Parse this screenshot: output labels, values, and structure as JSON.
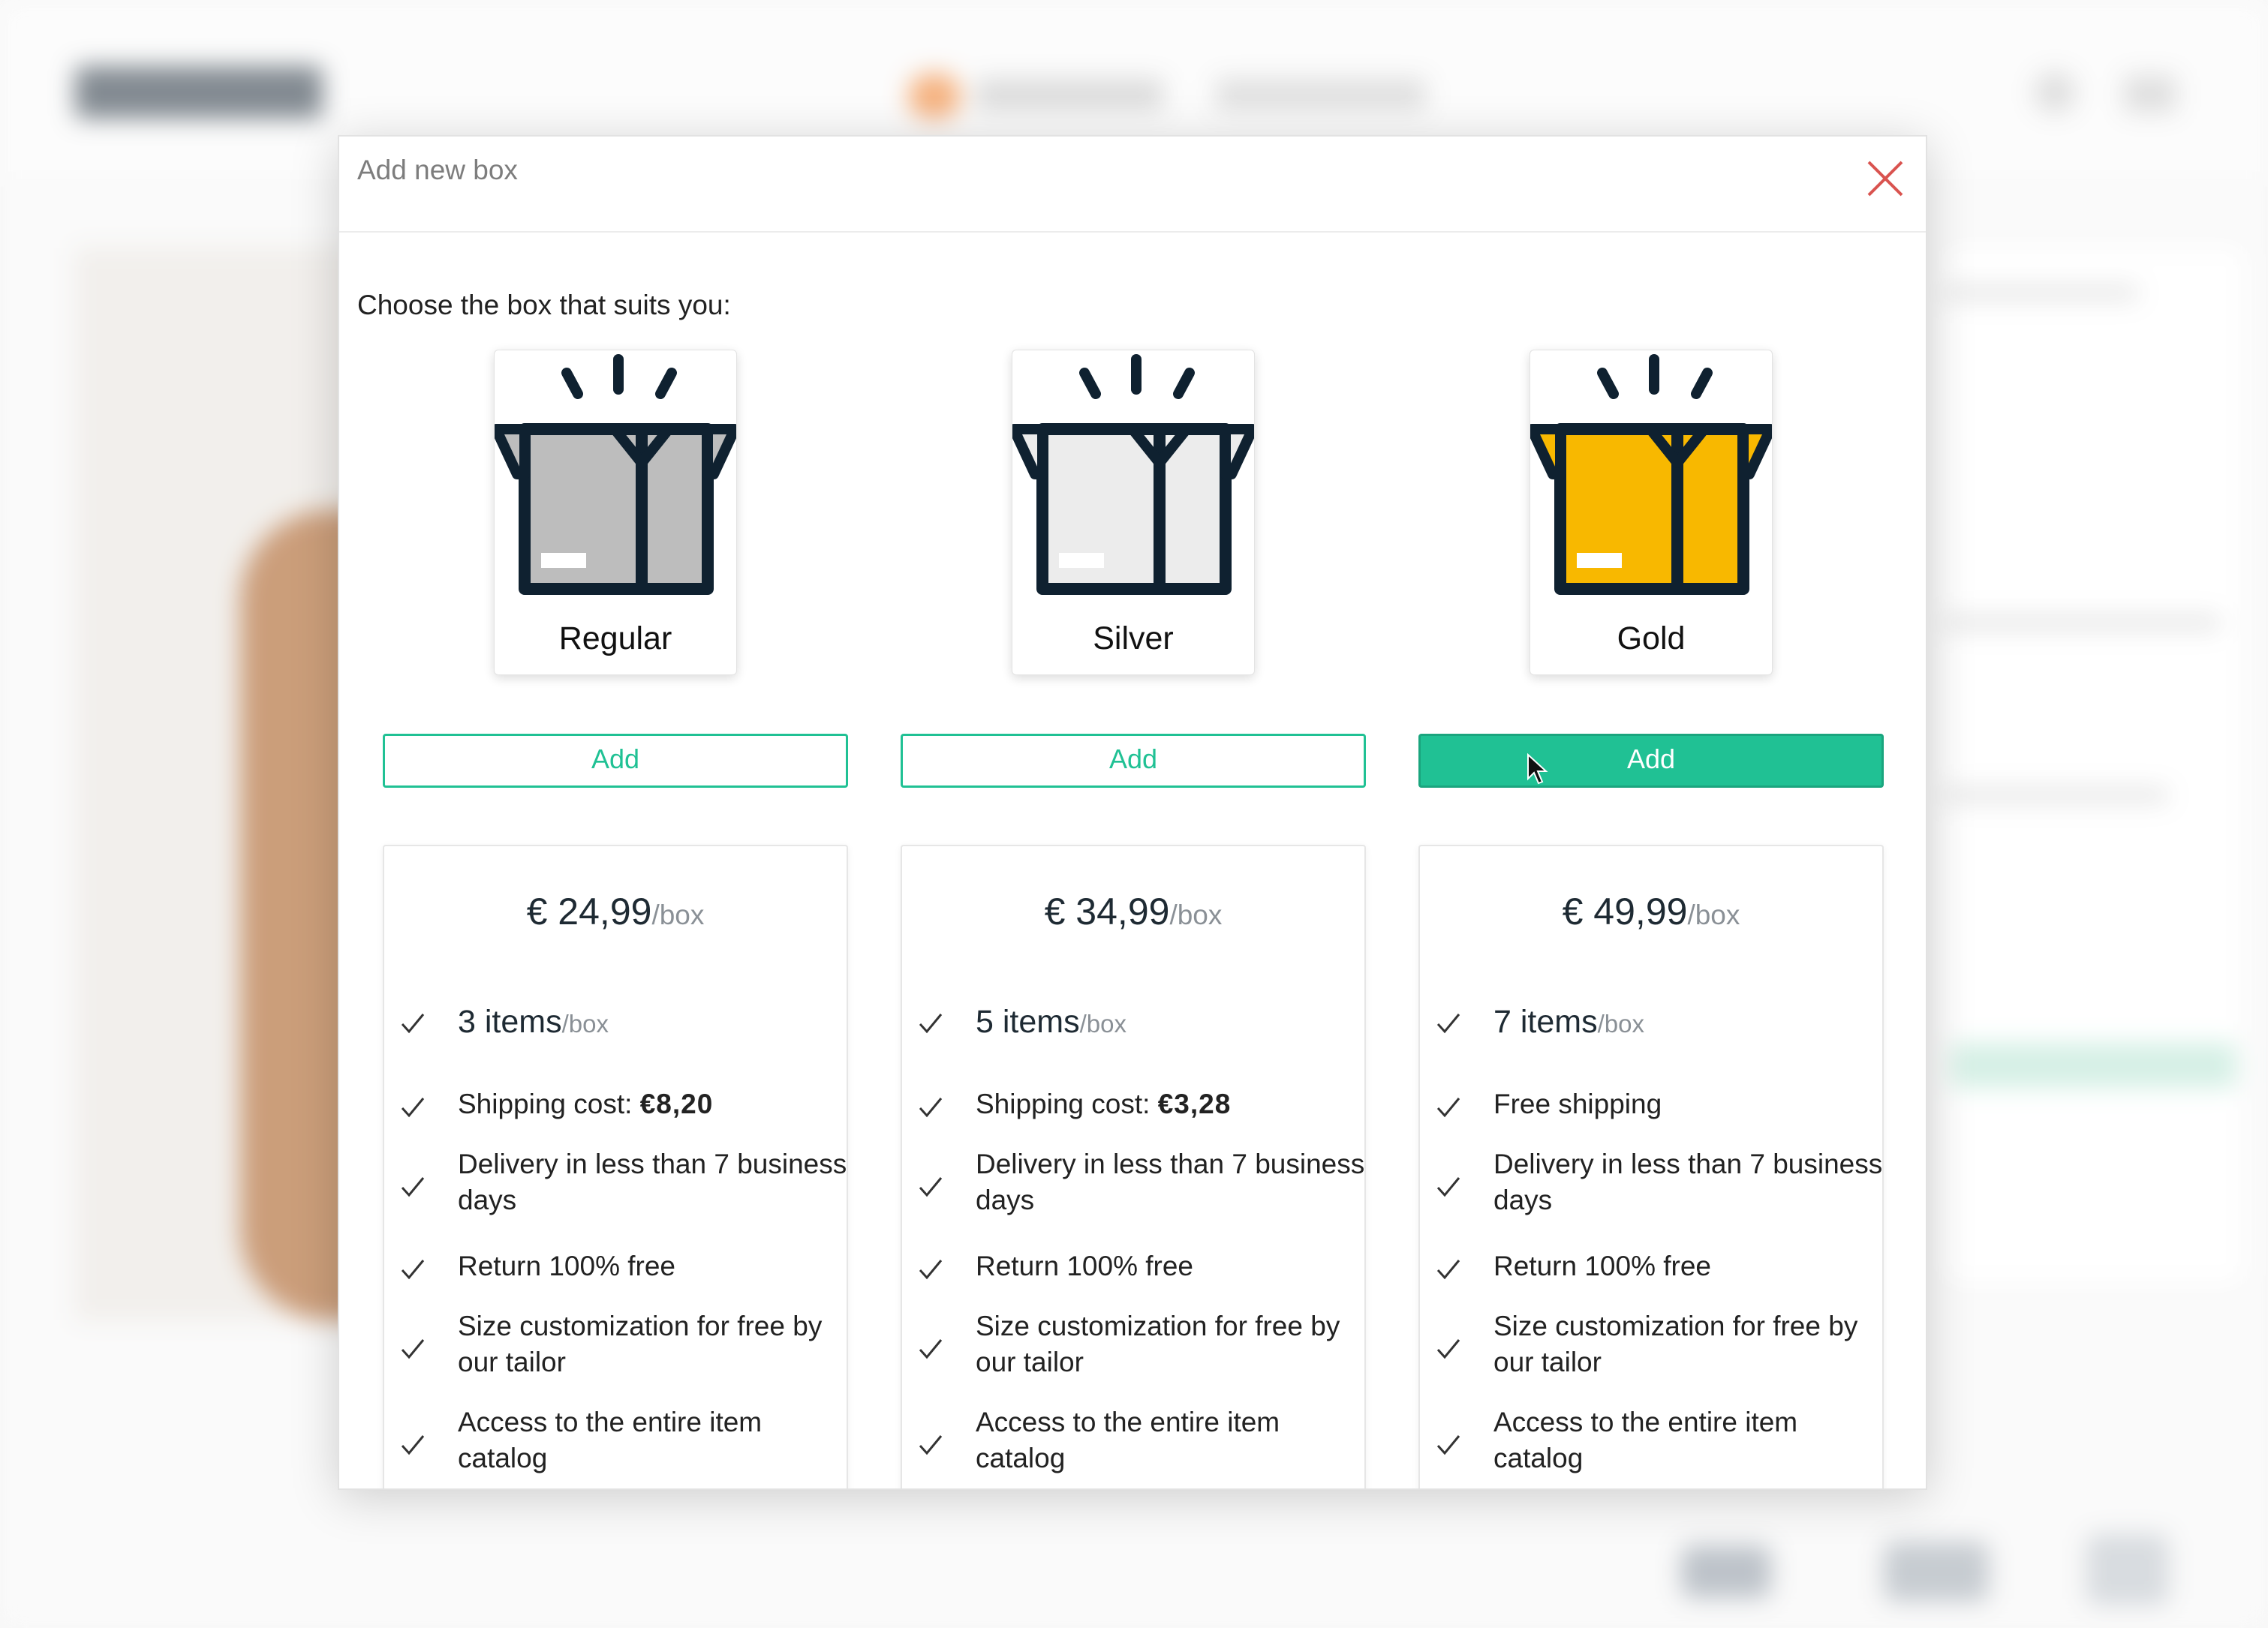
{
  "modal": {
    "title": "Add new box",
    "intro": "Choose the box that suits you:"
  },
  "colors": {
    "accent": "#20c194",
    "gold": "#f8b800",
    "regular": "#bdbdbd",
    "silver": "#ececec",
    "outline": "#0f2130",
    "close": "#d9534f"
  },
  "boxes": [
    {
      "name": "Regular",
      "add_label": "Add",
      "price": "€ 24,99",
      "price_unit": "/box",
      "items": "3 items",
      "items_unit": "/box",
      "shipping_label": "Shipping cost:",
      "shipping_value": "€8,20",
      "delivery": "Delivery in less than 7 business days",
      "return": "Return 100% free",
      "size": "Size customization for free by our tailor",
      "catalog": "Access to the entire item catalog"
    },
    {
      "name": "Silver",
      "add_label": "Add",
      "price": "€ 34,99",
      "price_unit": "/box",
      "items": "5 items",
      "items_unit": "/box",
      "shipping_label": "Shipping cost:",
      "shipping_value": "€3,28",
      "delivery": "Delivery in less than 7 business days",
      "return": "Return 100% free",
      "size": "Size customization for free by our tailor",
      "catalog": "Access to the entire item catalog"
    },
    {
      "name": "Gold",
      "add_label": "Add",
      "price": "€ 49,99",
      "price_unit": "/box",
      "items": "7 items",
      "items_unit": "/box",
      "shipping_label": "Free shipping",
      "shipping_value": "",
      "delivery": "Delivery in less than 7 business days",
      "return": "Return 100% free",
      "size": "Size customization for free by our tailor",
      "catalog": "Access to the entire item catalog"
    }
  ]
}
